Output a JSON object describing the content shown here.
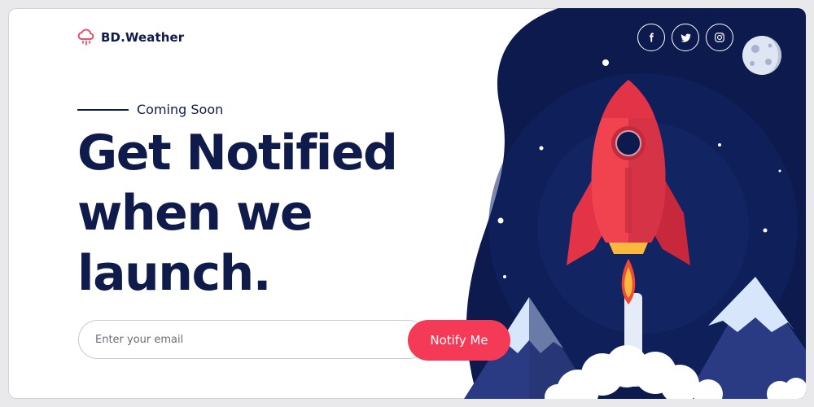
{
  "brand": {
    "name": "BD.Weather",
    "icon": "cloud-rain-icon"
  },
  "hero": {
    "kicker": "Coming Soon",
    "headline_lines": [
      "Get Notified",
      "when we",
      "launch."
    ]
  },
  "signup": {
    "email_placeholder": "Enter your email",
    "button_label": "Notify Me"
  },
  "social": [
    {
      "name": "facebook",
      "icon": "facebook-icon"
    },
    {
      "name": "twitter",
      "icon": "twitter-icon"
    },
    {
      "name": "instagram",
      "icon": "instagram-icon"
    }
  ],
  "colors": {
    "navy_text": "#0f1b4a",
    "accent_red": "#f43a56",
    "night_sky": "#0c1a4e",
    "rocket_red": "#f1424f",
    "mountain": "#cfe0f8",
    "background": "#ffffff"
  }
}
